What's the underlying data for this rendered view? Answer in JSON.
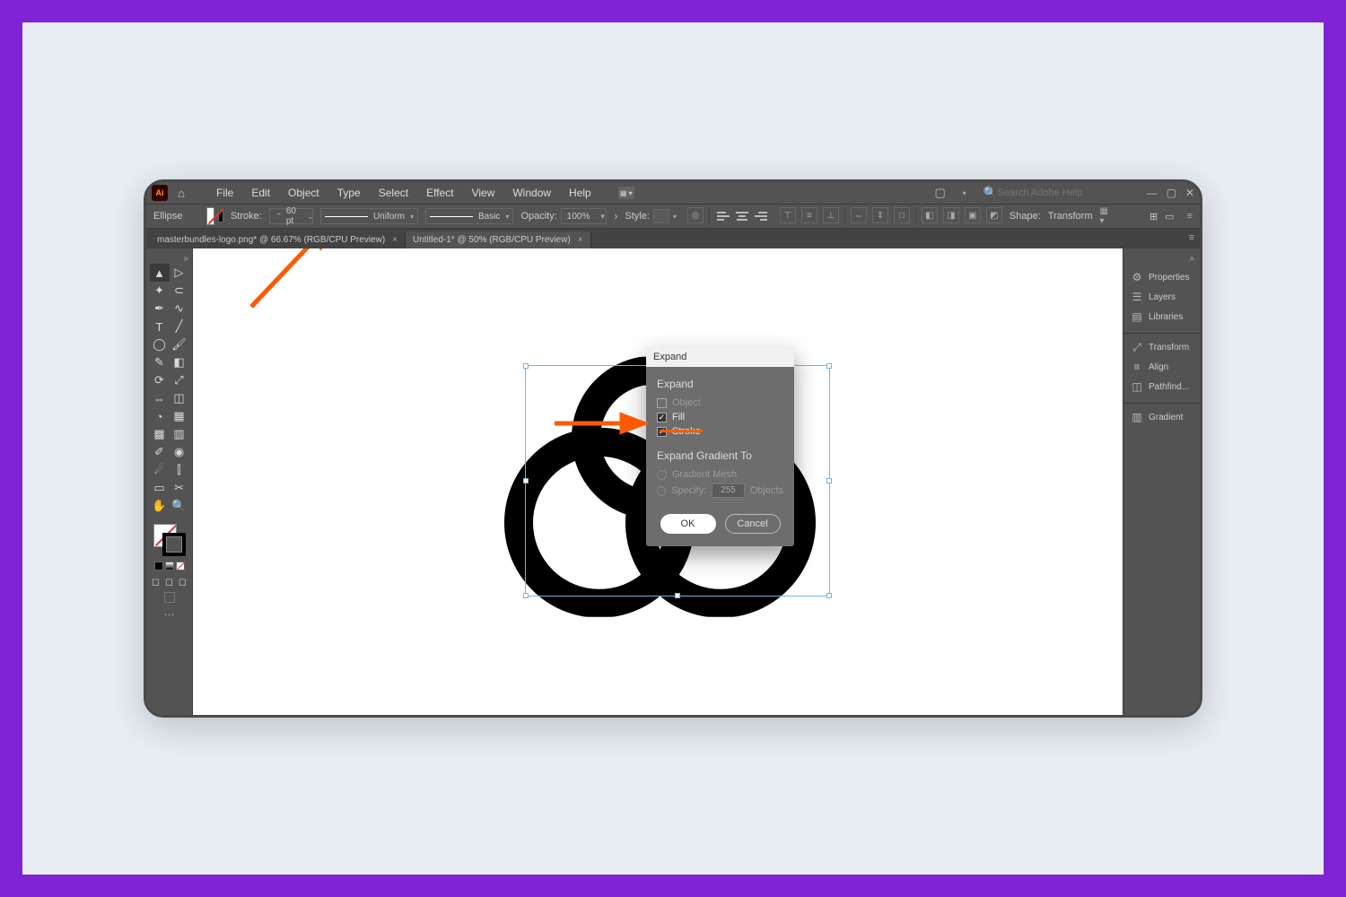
{
  "colors": {
    "accent": "#ff5a00",
    "frame": "#8022d6"
  },
  "menubar": {
    "items": [
      "File",
      "Edit",
      "Object",
      "Type",
      "Select",
      "Effect",
      "View",
      "Window",
      "Help"
    ],
    "search_placeholder": "Search Adobe Help"
  },
  "ctrlbar": {
    "tool_label": "Ellipse",
    "stroke_label": "Stroke:",
    "stroke_value": "60 pt",
    "profile_label": "Uniform",
    "brush_label": "Basic",
    "opacity_label": "Opacity:",
    "opacity_value": "100%",
    "style_label": "Style:",
    "shape_label": "Shape:",
    "transform_label": "Transform"
  },
  "tabs": [
    {
      "label": "masterbundles-logo.png* @ 66.67% (RGB/CPU Preview)",
      "active": false
    },
    {
      "label": "Untitled-1* @ 50% (RGB/CPU Preview)",
      "active": true
    }
  ],
  "rightpanel": {
    "groups": [
      [
        "Properties",
        "Layers",
        "Libraries"
      ],
      [
        "Transform",
        "Align",
        "Pathfind..."
      ],
      [
        "Gradient"
      ]
    ]
  },
  "dialog": {
    "title": "Expand",
    "sec1": "Expand",
    "opt_object": "Object",
    "opt_fill": "Fill",
    "opt_stroke": "Stroke",
    "sec2": "Expand Gradient To",
    "opt_mesh": "Gradient Mesh",
    "opt_specify": "Specify:",
    "opt_specify_val": "255",
    "opt_specify_unit": "Objects",
    "ok": "OK",
    "cancel": "Cancel"
  }
}
